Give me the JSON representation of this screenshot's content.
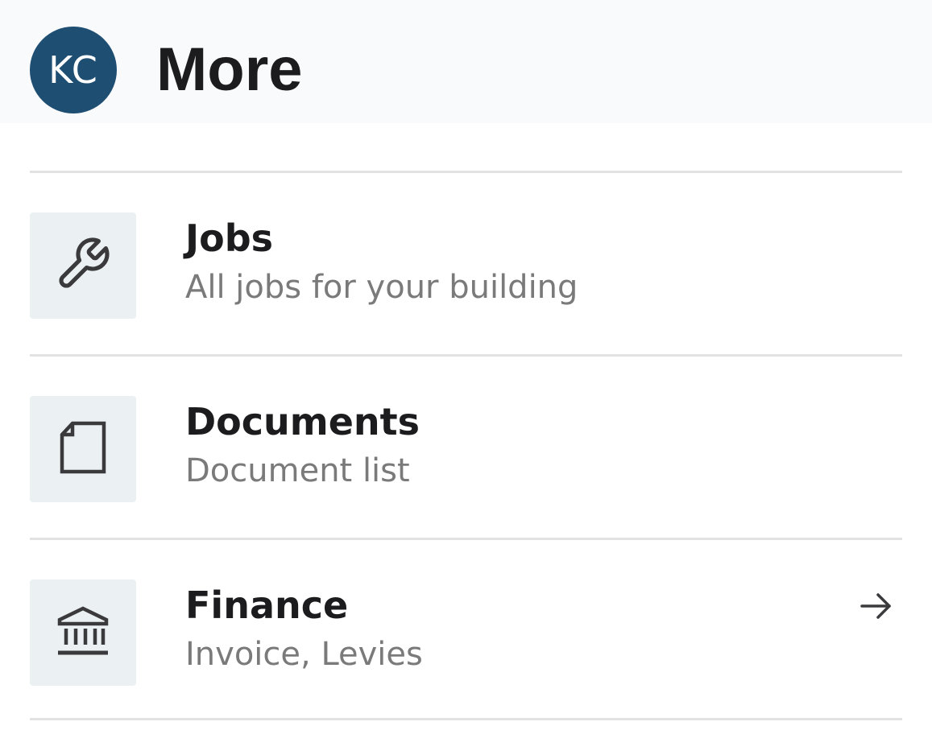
{
  "header": {
    "avatar_initials": "KC",
    "avatar_color": "#1f4e73",
    "title": "More"
  },
  "menu": {
    "items": [
      {
        "title": "Jobs",
        "subtitle": "All jobs for your building",
        "icon": "wrench-icon",
        "has_arrow": false
      },
      {
        "title": "Documents",
        "subtitle": "Document list",
        "icon": "document-icon",
        "has_arrow": false
      },
      {
        "title": "Finance",
        "subtitle": "Invoice, Levies",
        "icon": "bank-icon",
        "has_arrow": true,
        "arrow_icon": "arrow-right-icon"
      }
    ]
  },
  "colors": {
    "title_text": "#1c1c1e",
    "subtitle_text": "#7a7a7a",
    "icon_tile": "#ebf0f3",
    "divider": "#e2e2e2",
    "header_bg": "#f9fafc"
  }
}
